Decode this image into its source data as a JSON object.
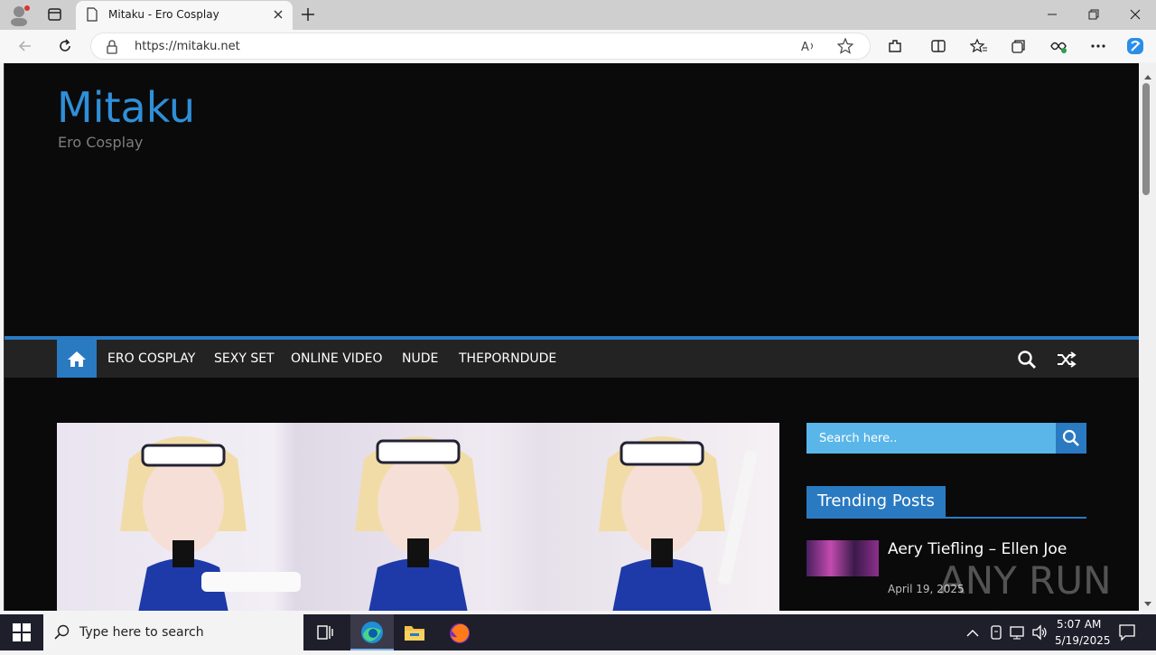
{
  "browser": {
    "tab_title": "Mitaku - Ero Cosplay",
    "url": "https://mitaku.net"
  },
  "site": {
    "title": "Mitaku",
    "tagline": "Ero Cosplay",
    "accent_color": "#2a7ac2",
    "menu": [
      "ERO COSPLAY",
      "SEXY SET",
      "ONLINE VIDEO",
      "NUDE",
      "THEPORNDUDE"
    ]
  },
  "sidebar": {
    "search_placeholder": "Search here..",
    "trending_label": "Trending Posts",
    "post": {
      "title": "Aery Tiefling – Ellen Joe",
      "date": "April 19, 2025"
    }
  },
  "taskbar": {
    "search_placeholder": "Type here to search",
    "time": "5:07 AM",
    "date": "5/19/2025"
  },
  "watermark": "ANY RUN"
}
